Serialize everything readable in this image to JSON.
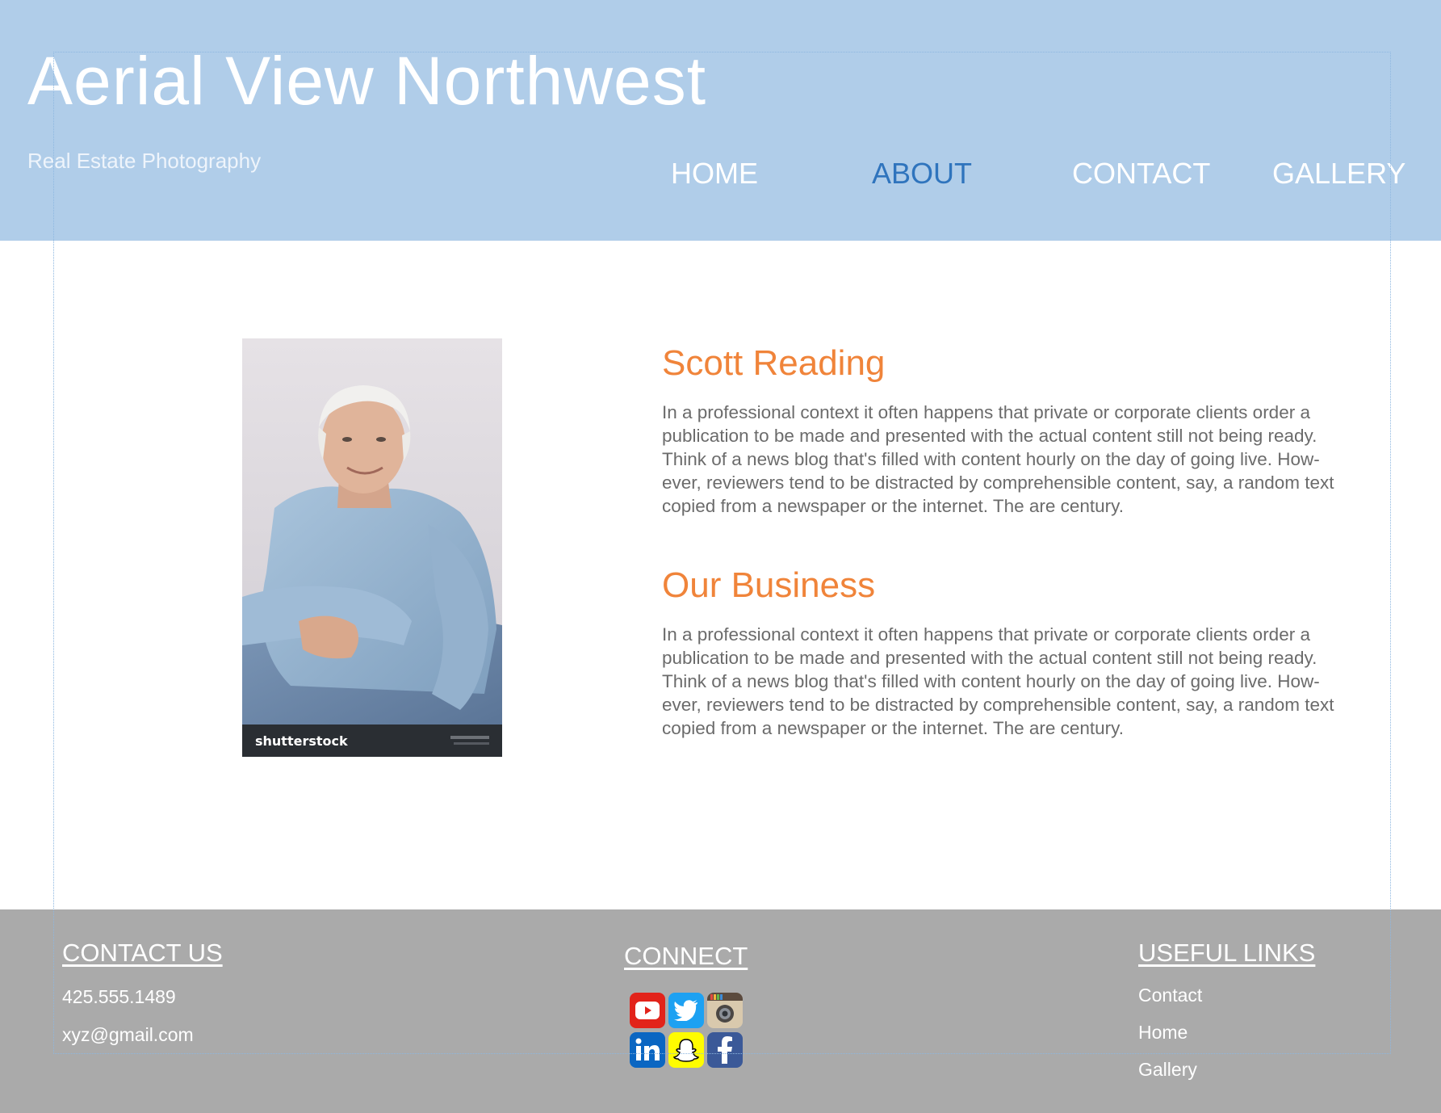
{
  "header": {
    "site_title": "Aerial View Northwest",
    "subtitle": "Real Estate Photography",
    "nav": [
      {
        "label": "HOME",
        "active": false
      },
      {
        "label": "ABOUT",
        "active": true
      },
      {
        "label": "CONTACT",
        "active": false
      },
      {
        "label": "GALLERY",
        "active": false
      }
    ]
  },
  "main": {
    "photo": {
      "watermark": "shutterstock",
      "subject": "portrait of smiling older man in denim shirt"
    },
    "sections": [
      {
        "heading": "Scott Reading",
        "body": "In a professional context it often happens that private or corporate clients order a publication to be made and presented with the actual content still not being ready. Think of a news blog that's filled with content hourly on the day of going live. How-ever, reviewers tend to be distracted by comprehensible content, say, a random text copied from a newspaper or the internet. The are century."
      },
      {
        "heading": "Our Business",
        "body": "In a professional context it often happens that private or corporate clients order a publication to be made and presented with the actual content still not being ready. Think of a news blog that's filled with content hourly on the day of going live. How-ever, reviewers tend to be distracted by comprehensible content, say, a random text copied from a newspaper or the internet. The are century."
      }
    ]
  },
  "footer": {
    "contact": {
      "heading": "CONTACT US",
      "phone": "425.555.1489",
      "email": "xyz@gmail.com"
    },
    "connect": {
      "heading": "CONNECT",
      "icons": [
        "youtube-icon",
        "twitter-icon",
        "instagram-icon",
        "linkedin-icon",
        "snapchat-icon",
        "facebook-icon"
      ]
    },
    "links": {
      "heading": "USEFUL LINKS",
      "items": [
        "Contact",
        "Home",
        "Gallery"
      ]
    }
  },
  "colors": {
    "header_bg": "#b0cde9",
    "nav_active": "#2f74bd",
    "heading_accent": "#f0843a",
    "body_text": "#6b6b6b",
    "footer_bg": "#aaaaaa"
  }
}
